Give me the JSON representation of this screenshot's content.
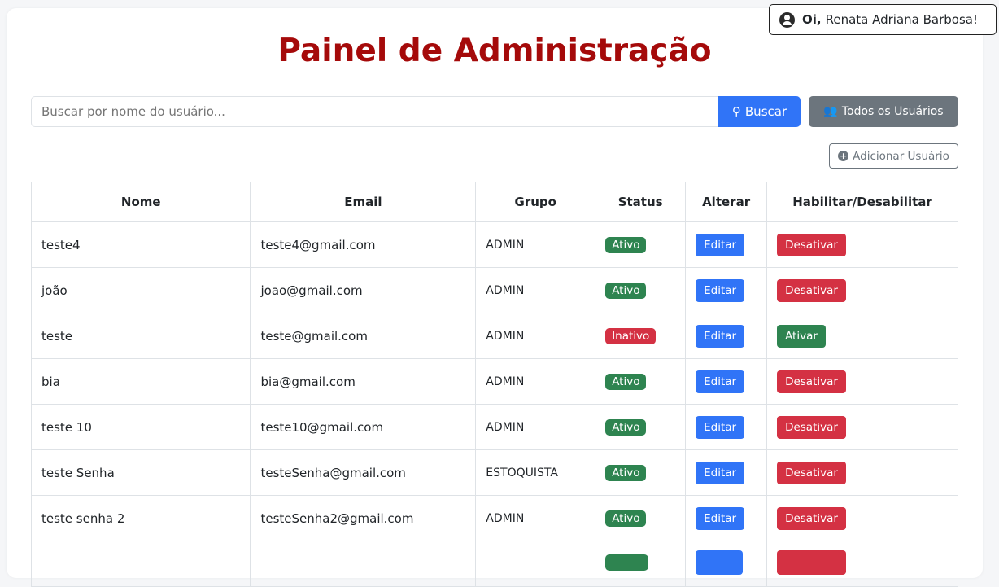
{
  "header": {
    "greeting_prefix": "Oi,",
    "user_name": "Renata Adriana Barbosa!",
    "title": "Painel de Administração"
  },
  "search": {
    "placeholder": "Buscar por nome do usuário...",
    "value": "",
    "search_label": "Buscar",
    "all_users_label": "Todos os Usuários",
    "add_user_label": "Adicionar Usuário"
  },
  "table": {
    "headers": [
      "Nome",
      "Email",
      "Grupo",
      "Status",
      "Alterar",
      "Habilitar/Desabilitar"
    ],
    "rows": [
      {
        "nome": "teste4",
        "email": "teste4@gmail.com",
        "grupo": "ADMIN",
        "status": "Ativo",
        "edit": "Editar",
        "toggle": "Desativar"
      },
      {
        "nome": "joão",
        "email": "joao@gmail.com",
        "grupo": "ADMIN",
        "status": "Ativo",
        "edit": "Editar",
        "toggle": "Desativar"
      },
      {
        "nome": "teste",
        "email": "teste@gmail.com",
        "grupo": "ADMIN",
        "status": "Inativo",
        "edit": "Editar",
        "toggle": "Ativar"
      },
      {
        "nome": "bia",
        "email": "bia@gmail.com",
        "grupo": "ADMIN",
        "status": "Ativo",
        "edit": "Editar",
        "toggle": "Desativar"
      },
      {
        "nome": "teste 10",
        "email": "teste10@gmail.com",
        "grupo": "ADMIN",
        "status": "Ativo",
        "edit": "Editar",
        "toggle": "Desativar"
      },
      {
        "nome": "teste Senha",
        "email": "testeSenha@gmail.com",
        "grupo": "ESTOQUISTA",
        "status": "Ativo",
        "edit": "Editar",
        "toggle": "Desativar"
      },
      {
        "nome": "teste senha 2",
        "email": "testeSenha2@gmail.com",
        "grupo": "ADMIN",
        "status": "Ativo",
        "edit": "Editar",
        "toggle": "Desativar"
      }
    ]
  },
  "colors": {
    "title": "#a50a0a",
    "primary": "#3074f7",
    "secondary": "#6c757d",
    "success": "#2e8450",
    "danger": "#d43143"
  }
}
